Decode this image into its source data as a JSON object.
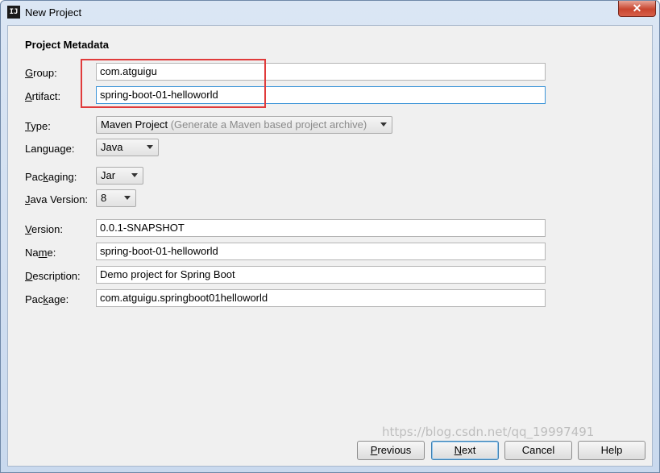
{
  "window": {
    "title": "New Project",
    "icon": "intellij-icon",
    "close_glyph": "✕",
    "icon_glyph": "IJ"
  },
  "section_title": "Project Metadata",
  "fields": {
    "group": {
      "access_key": "G",
      "label_rest": "roup:",
      "value": "com.atguigu"
    },
    "artifact": {
      "access_key": "A",
      "label_rest": "rtifact:",
      "value": "spring-boot-01-helloworld"
    },
    "version": {
      "access_key": "V",
      "label_rest": "ersion:",
      "value": "0.0.1-SNAPSHOT"
    },
    "name": {
      "label_pre": "Na",
      "access_key": "m",
      "label_rest": "e:",
      "value": "spring-boot-01-helloworld"
    },
    "description": {
      "access_key": "D",
      "label_rest": "escription:",
      "value": "Demo project for Spring Boot"
    },
    "package": {
      "label_pre": "Pac",
      "access_key": "k",
      "label_rest": "age:",
      "value": "com.atguigu.springboot01helloworld"
    }
  },
  "selects": {
    "type": {
      "access_key": "T",
      "label_rest": "ype:",
      "value": "Maven Project",
      "hint": "(Generate a Maven based project archive)"
    },
    "language": {
      "label_pre": "Lan",
      "access_key": "g",
      "label_rest": "uage:",
      "value": "Java"
    },
    "packaging": {
      "label_pre": "Pac",
      "access_key": "k",
      "label_rest": "aging:",
      "value": "Jar"
    },
    "java_version": {
      "access_key": "J",
      "label_rest": "ava Version:",
      "value": "8"
    }
  },
  "buttons": {
    "previous": {
      "access_key": "P",
      "label_rest": "revious"
    },
    "next": {
      "access_key": "N",
      "label_rest": "ext"
    },
    "cancel": {
      "label": "Cancel"
    },
    "help": {
      "label": "Help"
    }
  },
  "highlight_color": "#e03b3b",
  "focus_color": "#3d95d8",
  "watermark": "https://blog.csdn.net/qq_19997491"
}
